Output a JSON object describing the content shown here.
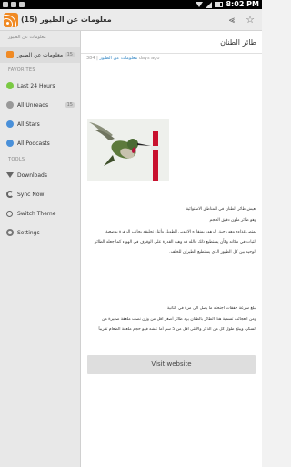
{
  "status_bar": {
    "time": "8:02 PM",
    "icons": [
      "notification-icon",
      "sms-icon",
      "gallery-icon",
      "wifi-icon",
      "signal-icon",
      "battery-icon"
    ]
  },
  "action_bar": {
    "title": "(15) معلومات عن الطيور",
    "app_icon": "rss-icon",
    "share_icon": "share-icon",
    "star_icon": "star-icon"
  },
  "drawer": {
    "header": "معلومات عن الطيور",
    "feed": {
      "label": "معلومات عن الطيور",
      "count": "15"
    },
    "favorites_label": "FAVORITES",
    "favorites": [
      {
        "label": "Last 24 Hours",
        "count": ""
      },
      {
        "label": "All Unreads",
        "count": "15"
      },
      {
        "label": "All Stars",
        "count": ""
      },
      {
        "label": "All Podcasts",
        "count": ""
      }
    ],
    "tools_label": "TOOLS",
    "tools": [
      {
        "label": "Downloads"
      },
      {
        "label": "Sync Now"
      },
      {
        "label": "Switch Theme"
      },
      {
        "label": "Settings"
      }
    ]
  },
  "article": {
    "title": "طائر الطنان",
    "meta_count": "384",
    "meta_feed": "معلومات عن الطيور",
    "meta_time": "days ago",
    "paragraphs": [
      "يعيش طائر الطنان في المناطق الاستوائية",
      "وهو طائر ملون دقيق الحجم",
      "يمتص غذاءه وهو رحيق الزهور بمنقاره الانبوبي الطويل وأثناء تحليقه بجانب الزهرة بوضعية",
      "الثبات في مكانه وكأن يستطيع ذلك فالله قد وهبه القدرة على الوقوف في الهواء كما جعله الطائر",
      "الوحيد بين كل الطيور الذي يستطيع الطيران للخلف.",
      "تبلغ سرعة خفقات اجنحته ما يصل الى مرة في الثانية",
      "ومن العجائب تسمية هذا الطائر بالطنان يرد طائر أصغر اقل من وزن نصف ملعقة صغيرة من",
      "السكر، ويبلغ طول كل من الذكر والأنثى اقل من 5 سم أما عشه فهو حجم ملعقة الطعام تقريباً"
    ],
    "visit_label": "Visit website"
  },
  "colors": {
    "rss_orange": "#f08a24",
    "link_blue": "#3a8bc7",
    "drawer_bg": "#e8e8e8"
  }
}
